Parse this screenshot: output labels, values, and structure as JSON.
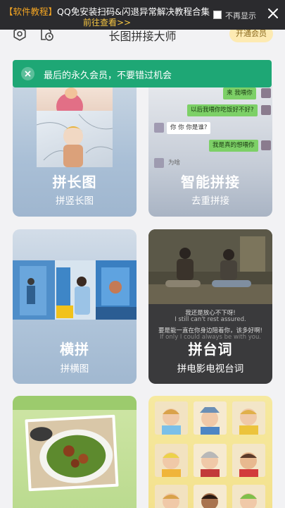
{
  "banner": {
    "tag": "【软件教程】",
    "text": "QQ免安装扫码&闪退异常解决教程合集",
    "link": "前往查看>>",
    "dont_show": "不再显示",
    "close_icon": "close-icon"
  },
  "header": {
    "title": "长图拼接大师",
    "vip": "开通会员",
    "settings_icon": "settings-icon",
    "history_icon": "history-icon"
  },
  "toast": {
    "message": "最后的永久会员，不要错过机会",
    "close_icon": "close-icon"
  },
  "cards": [
    {
      "title": "拼长图",
      "subtitle": "拼竖长图"
    },
    {
      "title": "智能拼接",
      "subtitle": "去重拼接"
    },
    {
      "title": "横拼",
      "subtitle": "拼横图"
    },
    {
      "title": "拼台词",
      "subtitle": "拼电影电视台词"
    }
  ],
  "chat": {
    "b1": "来 我喂你",
    "b2": "以后我喂你吃饭好不好?",
    "b3": "你 你 你是谁?",
    "b4": "我是真的想喂你",
    "b5": "为啥"
  },
  "subtitles": {
    "line1": "我还是放心不下呀!",
    "line2": "I still can't rest assured.",
    "line3": "要是能一直在你身边陪着你，该多好啊!",
    "line4": "If only I could always be with you."
  },
  "colors": {
    "toast": "#1ea775",
    "banner": "#2b2b2e",
    "vip_bg": "#fdeab2",
    "card_blue": "#a9c3dc",
    "card_dark": "#3a3a3c",
    "card_green": "#b8d98c",
    "card_yellow": "#f3e08a"
  }
}
